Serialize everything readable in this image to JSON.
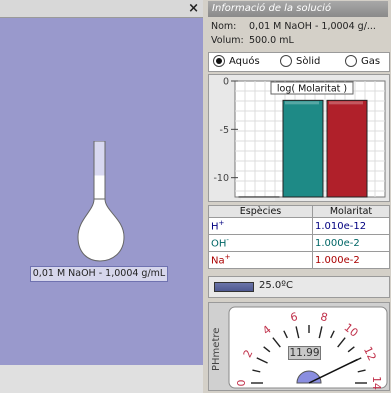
{
  "workspace": {
    "flask_label": "0,01 M NaOH - 1,0004 g/mL",
    "close_symbol": "×"
  },
  "info": {
    "header": "Informació de la solució",
    "nom_label": "Nom:",
    "nom_value": "0,01 M NaOH - 1,0004 g/...",
    "volum_label": "Volum:",
    "volum_value": "500.0 mL"
  },
  "state": {
    "options": [
      "Aquós",
      "Sòlid",
      "Gas"
    ],
    "selected": "Aquós"
  },
  "chart_data": {
    "type": "bar",
    "title": "log( Molaritat )",
    "categories": [
      "H+",
      "OH-",
      "Na+"
    ],
    "values": [
      -11.99,
      -2.0,
      -2.0
    ],
    "colors": [
      "#1f3a78",
      "#1e8a86",
      "#b0202a"
    ],
    "yticks": [
      "0",
      "-5",
      "-10"
    ],
    "ylim": [
      -12,
      0
    ]
  },
  "table": {
    "headers": [
      "Espècies",
      "Molaritat"
    ],
    "rows": [
      {
        "species": "H",
        "charge": "+",
        "value": "1.010e-12",
        "color": "#000080"
      },
      {
        "species": "OH",
        "charge": "-",
        "value": "1.000e-2",
        "color": "#006666"
      },
      {
        "species": "Na",
        "charge": "+",
        "value": "1.000e-2",
        "color": "#aa0000"
      }
    ]
  },
  "temperature": {
    "value_text": "25.0ºC"
  },
  "ph_meter": {
    "label": "PHmetre",
    "reading": "11.99",
    "ph": 11.99,
    "scale_labels": [
      "0",
      "2",
      "4",
      "6",
      "8",
      "10",
      "12",
      "14"
    ]
  }
}
